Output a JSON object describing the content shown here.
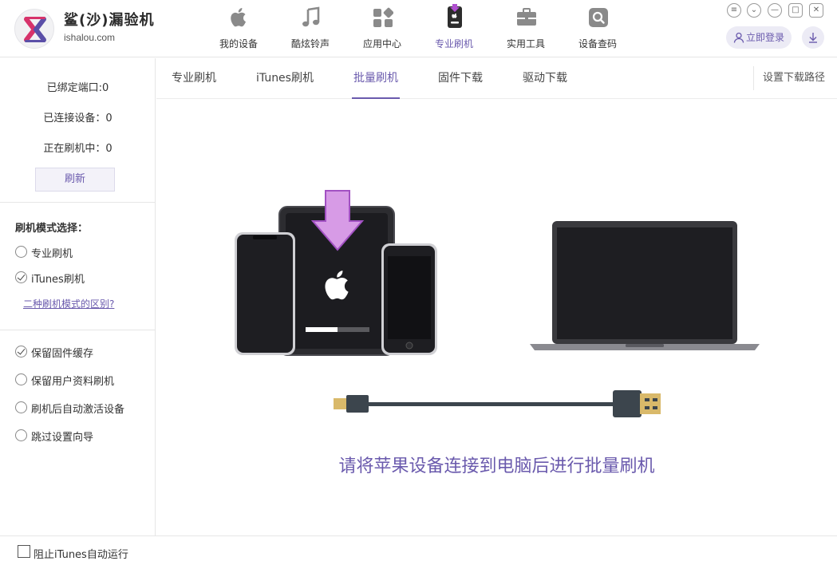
{
  "app": {
    "title": "鲨(沙)漏验机",
    "site": "ishalou.com",
    "accent_color": "#6a5aad"
  },
  "nav": [
    {
      "label": "我的设备",
      "icon": "apple-icon"
    },
    {
      "label": "酷炫铃声",
      "icon": "music-note-icon"
    },
    {
      "label": "应用中心",
      "icon": "apps-grid-icon"
    },
    {
      "label": "专业刷机",
      "icon": "flash-phone-icon",
      "active": true
    },
    {
      "label": "实用工具",
      "icon": "toolbox-icon"
    },
    {
      "label": "设备查码",
      "icon": "search-icon"
    }
  ],
  "window_controls": [
    "menu-icon",
    "chevron-down-icon",
    "minimize-icon",
    "maximize-icon",
    "close-icon"
  ],
  "header": {
    "login_label": "立即登录",
    "download_icon": "download-icon"
  },
  "sidebar": {
    "bound_ports": "已绑定端口:0",
    "connected_devices": "已连接设备：0",
    "flashing": "正在刷机中：0",
    "refresh_label": "刷新",
    "mode_title": "刷机模式选择：",
    "modes": [
      {
        "label": "专业刷机",
        "checked": false
      },
      {
        "label": "iTunes刷机",
        "checked": true
      }
    ],
    "diff_link": "二种刷机模式的区别?",
    "options": [
      {
        "label": "保留固件缓存",
        "checked": true
      },
      {
        "label": "保留用户资料刷机",
        "checked": false
      },
      {
        "label": "刷机后自动激活设备",
        "checked": false
      },
      {
        "label": "跳过设置向导",
        "checked": false
      }
    ]
  },
  "tabs": [
    {
      "label": "专业刷机",
      "active": false
    },
    {
      "label": "iTunes刷机",
      "active": false
    },
    {
      "label": "批量刷机",
      "active": true
    },
    {
      "label": "固件下载",
      "active": false
    },
    {
      "label": "驱动下载",
      "active": false
    }
  ],
  "download_path_label": "设置下载路径",
  "main": {
    "hint": "请将苹果设备连接到电脑后进行批量刷机",
    "flash_progress": 0.5
  },
  "bottom": {
    "block_itunes_label": "阻止iTunes自动运行",
    "block_itunes_checked": false
  }
}
